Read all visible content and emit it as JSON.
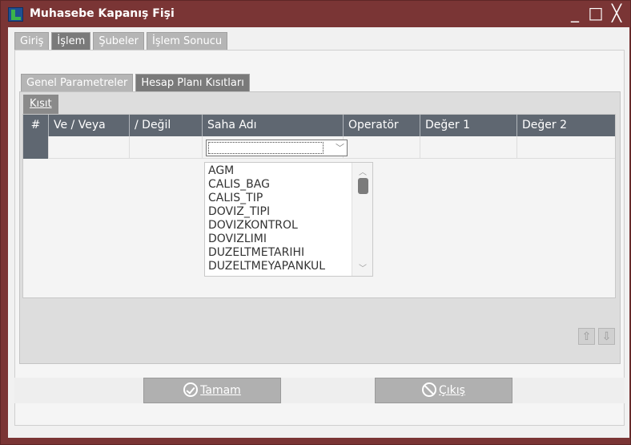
{
  "window": {
    "title": "Muhasebe Kapanış Fişi",
    "controls": [
      "_",
      "□",
      "╳"
    ]
  },
  "top_tabs": [
    {
      "label": "Giriş",
      "active": false
    },
    {
      "label": "İşlem",
      "active": true
    },
    {
      "label": "Şubeler",
      "active": false
    },
    {
      "label": "İşlem Sonucu",
      "active": false
    }
  ],
  "inner_tabs": [
    {
      "label": "Genel Parametreler",
      "active": false
    },
    {
      "label": "Hesap Planı Kısıtları",
      "active": true
    }
  ],
  "kisit_tab": {
    "label": "Kısıt"
  },
  "grid": {
    "columns": [
      "#",
      "Ve / Veya",
      "/ Değil",
      "Saha Adı",
      "Operatör",
      "Değer 1",
      "Değer 2"
    ]
  },
  "dropdown": {
    "items": [
      "AGM",
      "CALIS_BAG",
      "CALIS_TIP",
      "DOVIZ_TIPI",
      "DOVIZKONTROL",
      "DOVIZLIMI",
      "DUZELTMETARIHI",
      "DUZELTMEYAPANKUL"
    ]
  },
  "buttons": {
    "ok_label": "Tamam",
    "cancel_label": "Çıkış"
  },
  "colors": {
    "title_bar": "#7a3535",
    "grid_header": "#5f6771",
    "button": "#b0b0b0"
  }
}
